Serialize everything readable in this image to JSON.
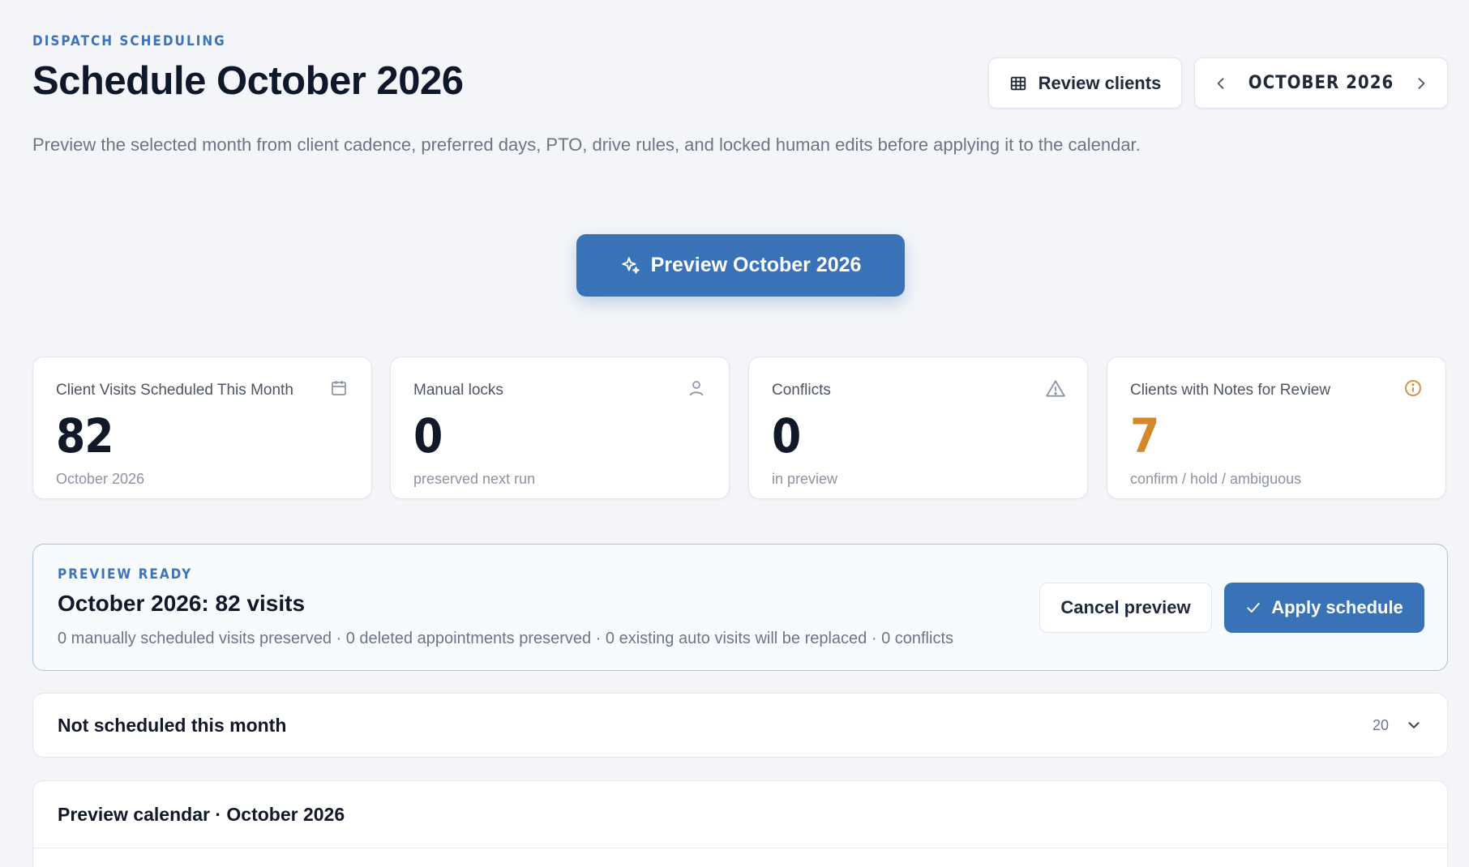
{
  "header": {
    "eyebrow": "DISPATCH SCHEDULING",
    "title": "Schedule October 2026",
    "subtitle": "Preview the selected month from client cadence, preferred days, PTO, drive rules, and locked human edits before applying it to the calendar.",
    "review_clients_label": "Review clients",
    "month_label": "OCTOBER 2026"
  },
  "preview_button": {
    "label": "Preview October 2026"
  },
  "stats": [
    {
      "label": "Client Visits Scheduled This Month",
      "value": "82",
      "sub": "October 2026",
      "icon": "calendar-icon"
    },
    {
      "label": "Manual locks",
      "value": "0",
      "sub": "preserved next run",
      "icon": "user-icon"
    },
    {
      "label": "Conflicts",
      "value": "0",
      "sub": "in preview",
      "icon": "warning-icon"
    },
    {
      "label": "Clients with Notes for Review",
      "value": "7",
      "sub": "confirm / hold / ambiguous",
      "icon": "info-icon",
      "accent": "#d4882a"
    }
  ],
  "ready": {
    "tag": "PREVIEW READY",
    "title": "October 2026: 82 visits",
    "description": "0 manually scheduled visits preserved · 0 deleted appointments preserved · 0 existing auto visits will be replaced · 0 conflicts",
    "cancel_label": "Cancel preview",
    "apply_label": "Apply schedule"
  },
  "not_scheduled": {
    "title": "Not scheduled this month",
    "count": "20"
  },
  "calendar": {
    "title": "Preview calendar · October 2026"
  },
  "colors": {
    "accent": "#3a72b8",
    "warning": "#d4882a",
    "background": "#f3f5f9"
  }
}
